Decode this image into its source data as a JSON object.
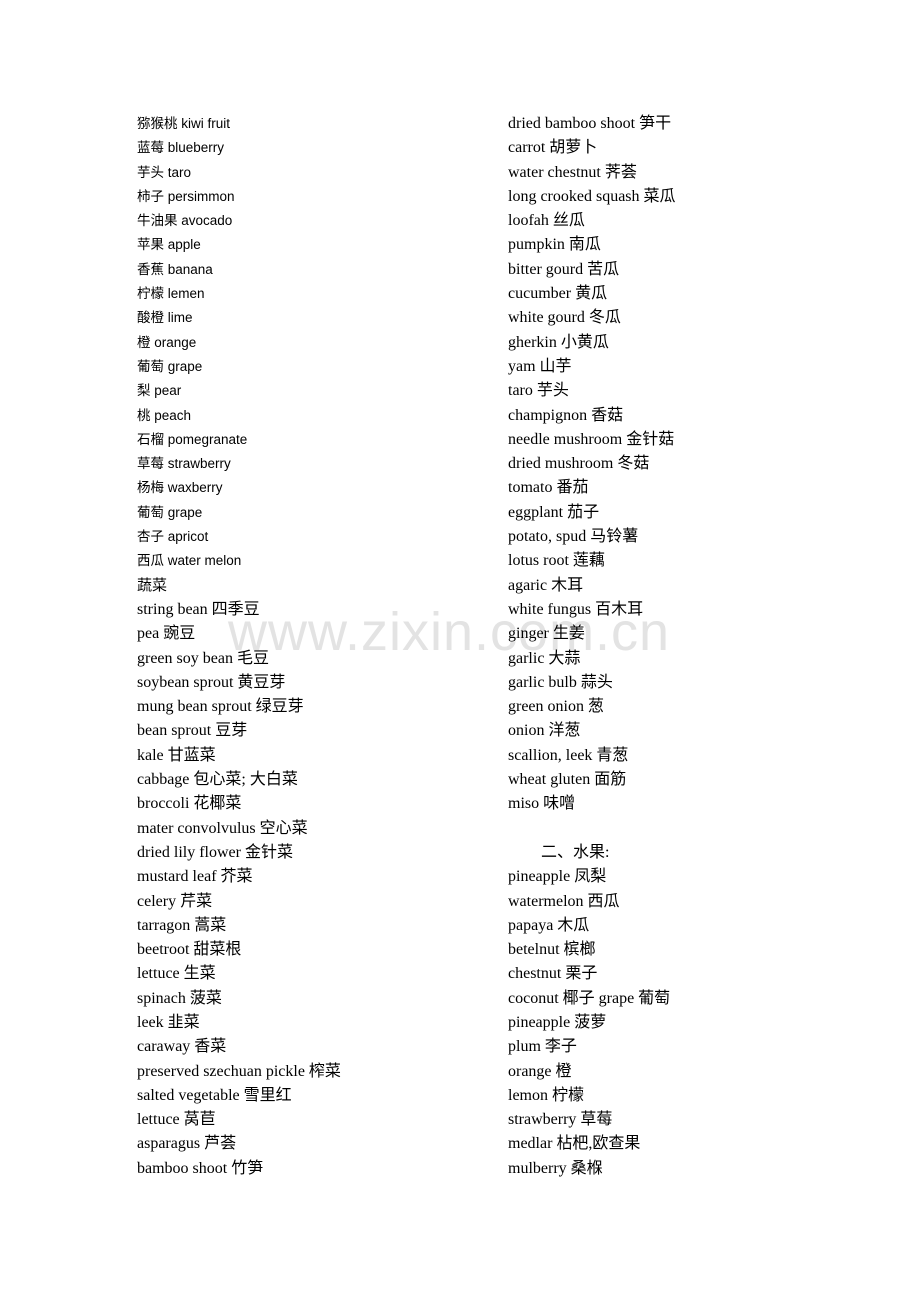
{
  "document": {
    "title": "食物中英文对照词汇表",
    "watermark": "www.zixin.com.cn",
    "background_color": "#ffffff",
    "text_color": "#000000",
    "watermark_color": "#e3e3e3"
  },
  "left_column": {
    "lines": [
      {
        "text": "猕猴桃  kiwi fruit",
        "style": "sans"
      },
      {
        "text": "蓝莓 blueberry",
        "style": "sans"
      },
      {
        "text": "芋头 taro",
        "style": "sans"
      },
      {
        "text": "柿子 persimmon",
        "style": "sans"
      },
      {
        "text": "牛油果 avocado",
        "style": "sans"
      },
      {
        "text": "苹果 apple",
        "style": "sans"
      },
      {
        "text": "香蕉 banana",
        "style": "sans"
      },
      {
        "text": "柠檬 lemen",
        "style": "sans"
      },
      {
        "text": "酸橙 lime",
        "style": "sans"
      },
      {
        "text": "橙 orange",
        "style": "sans"
      },
      {
        "text": "葡萄 grape",
        "style": "sans"
      },
      {
        "text": "梨 pear",
        "style": "sans"
      },
      {
        "text": "桃 peach",
        "style": "sans"
      },
      {
        "text": "石榴 pomegranate",
        "style": "sans"
      },
      {
        "text": "草莓 strawberry",
        "style": "sans"
      },
      {
        "text": "杨梅 waxberry",
        "style": "sans"
      },
      {
        "text": "葡萄 grape",
        "style": "sans"
      },
      {
        "text": "杏子 apricot",
        "style": "sans"
      },
      {
        "text": "西瓜 water melon",
        "style": "sans"
      },
      {
        "text": "蔬菜",
        "style": "sans-big"
      },
      {
        "text": "string bean 四季豆",
        "style": "serif"
      },
      {
        "text": "pea 豌豆",
        "style": "serif"
      },
      {
        "text": "green soy bean 毛豆",
        "style": "serif"
      },
      {
        "text": "soybean sprout 黄豆芽",
        "style": "serif"
      },
      {
        "text": "mung bean sprout 绿豆芽",
        "style": "serif"
      },
      {
        "text": "bean sprout 豆芽",
        "style": "serif"
      },
      {
        "text": "kale 甘蓝菜",
        "style": "serif"
      },
      {
        "text": "cabbage 包心菜; 大白菜",
        "style": "serif"
      },
      {
        "text": "broccoli 花椰菜",
        "style": "serif"
      },
      {
        "text": "mater convolvulus 空心菜",
        "style": "serif"
      },
      {
        "text": "dried lily flower 金针菜",
        "style": "serif"
      },
      {
        "text": "mustard leaf 芥菜",
        "style": "serif"
      },
      {
        "text": "celery 芹菜",
        "style": "serif"
      },
      {
        "text": "tarragon 蒿菜",
        "style": "serif"
      },
      {
        "text": "beetroot 甜菜根",
        "style": "serif"
      },
      {
        "text": "lettuce 生菜",
        "style": "serif"
      },
      {
        "text": "spinach 菠菜",
        "style": "serif"
      },
      {
        "text": "leek 韭菜",
        "style": "serif"
      },
      {
        "text": "caraway 香菜",
        "style": "serif"
      },
      {
        "text": "preserved szechuan pickle 榨菜",
        "style": "serif"
      },
      {
        "text": "salted vegetable 雪里红",
        "style": "serif"
      },
      {
        "text": "lettuce 莴苣",
        "style": "serif"
      },
      {
        "text": "asparagus 芦荟",
        "style": "serif"
      },
      {
        "text": "bamboo shoot 竹笋",
        "style": "serif"
      }
    ]
  },
  "right_column": {
    "lines": [
      {
        "text": "dried bamboo shoot 笋干",
        "style": "serif"
      },
      {
        "text": "carrot 胡萝卜",
        "style": "serif"
      },
      {
        "text": "water chestnut 荠荟",
        "style": "serif"
      },
      {
        "text": "long crooked squash 菜瓜",
        "style": "serif"
      },
      {
        "text": "loofah 丝瓜",
        "style": "serif"
      },
      {
        "text": "pumpkin 南瓜",
        "style": "serif"
      },
      {
        "text": "bitter gourd 苦瓜",
        "style": "serif"
      },
      {
        "text": "cucumber 黄瓜",
        "style": "serif"
      },
      {
        "text": "white gourd 冬瓜",
        "style": "serif"
      },
      {
        "text": "gherkin 小黄瓜",
        "style": "serif"
      },
      {
        "text": "yam 山芋",
        "style": "serif"
      },
      {
        "text": "taro 芋头",
        "style": "serif"
      },
      {
        "text": "champignon 香菇",
        "style": "serif"
      },
      {
        "text": "needle mushroom 金针菇",
        "style": "serif"
      },
      {
        "text": "dried mushroom 冬菇",
        "style": "serif"
      },
      {
        "text": "tomato 番茄",
        "style": "serif"
      },
      {
        "text": "eggplant 茄子",
        "style": "serif"
      },
      {
        "text": "potato, spud 马铃薯",
        "style": "serif"
      },
      {
        "text": "lotus root 莲藕",
        "style": "serif"
      },
      {
        "text": "agaric 木耳",
        "style": "serif"
      },
      {
        "text": "white fungus 百木耳",
        "style": "serif"
      },
      {
        "text": "ginger 生姜",
        "style": "serif"
      },
      {
        "text": "garlic 大蒜",
        "style": "serif"
      },
      {
        "text": "garlic bulb 蒜头",
        "style": "serif"
      },
      {
        "text": "green onion 葱",
        "style": "serif"
      },
      {
        "text": "onion 洋葱",
        "style": "serif"
      },
      {
        "text": "scallion, leek 青葱",
        "style": "serif"
      },
      {
        "text": "wheat gluten 面筋",
        "style": "serif"
      },
      {
        "text": "miso 味噌",
        "style": "serif"
      },
      {
        "text": "",
        "style": "blank"
      },
      {
        "text": "二、水果:",
        "style": "heading"
      },
      {
        "text": "pineapple 凤梨",
        "style": "serif"
      },
      {
        "text": "watermelon 西瓜",
        "style": "serif"
      },
      {
        "text": "papaya 木瓜",
        "style": "serif"
      },
      {
        "text": "betelnut 槟榔",
        "style": "serif"
      },
      {
        "text": "chestnut 栗子",
        "style": "serif"
      },
      {
        "text": "coconut 椰子 grape 葡萄",
        "style": "serif"
      },
      {
        "text": "pineapple 菠萝",
        "style": "serif"
      },
      {
        "text": "plum 李子",
        "style": "serif"
      },
      {
        "text": "orange 橙",
        "style": "serif"
      },
      {
        "text": "lemon 柠檬",
        "style": "serif"
      },
      {
        "text": "strawberry 草莓",
        "style": "serif"
      },
      {
        "text": "medlar 枮杷,欧查果",
        "style": "serif"
      },
      {
        "text": "mulberry 桑椺",
        "style": "serif"
      }
    ]
  }
}
